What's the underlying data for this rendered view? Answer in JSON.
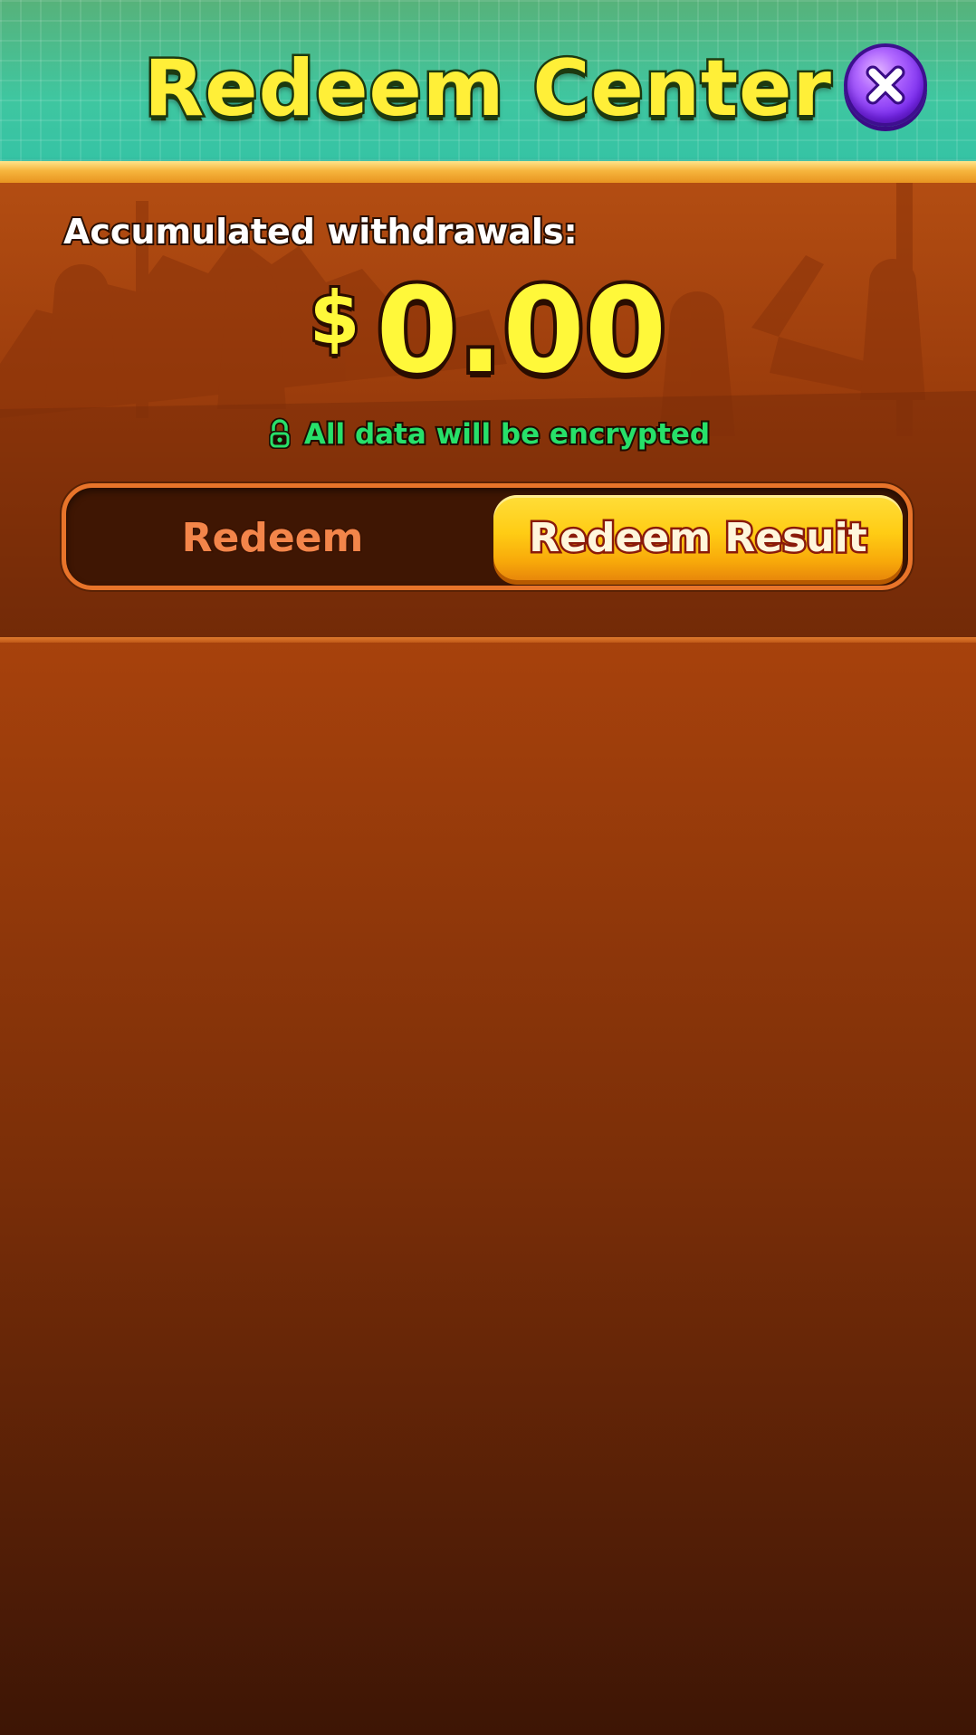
{
  "header": {
    "title": "Redeem Center",
    "close_icon": "close-icon"
  },
  "summary": {
    "label": "Accumulated withdrawals:",
    "currency": "$",
    "amount": "0.00",
    "encryption_note": "All data will be encrypted",
    "lock_icon": "lock-icon"
  },
  "tabs": {
    "items": [
      {
        "label": "Redeem",
        "selected": false
      },
      {
        "label": "Redeem Resuit",
        "selected": true
      }
    ]
  },
  "colors": {
    "title_fill": "#ffef38",
    "amount_fill": "#fff83a",
    "encryption_text": "#27e06a",
    "active_tab": "#ffcc14",
    "inactive_tab_text": "#f3854a",
    "close_button": "#9a4bff"
  }
}
